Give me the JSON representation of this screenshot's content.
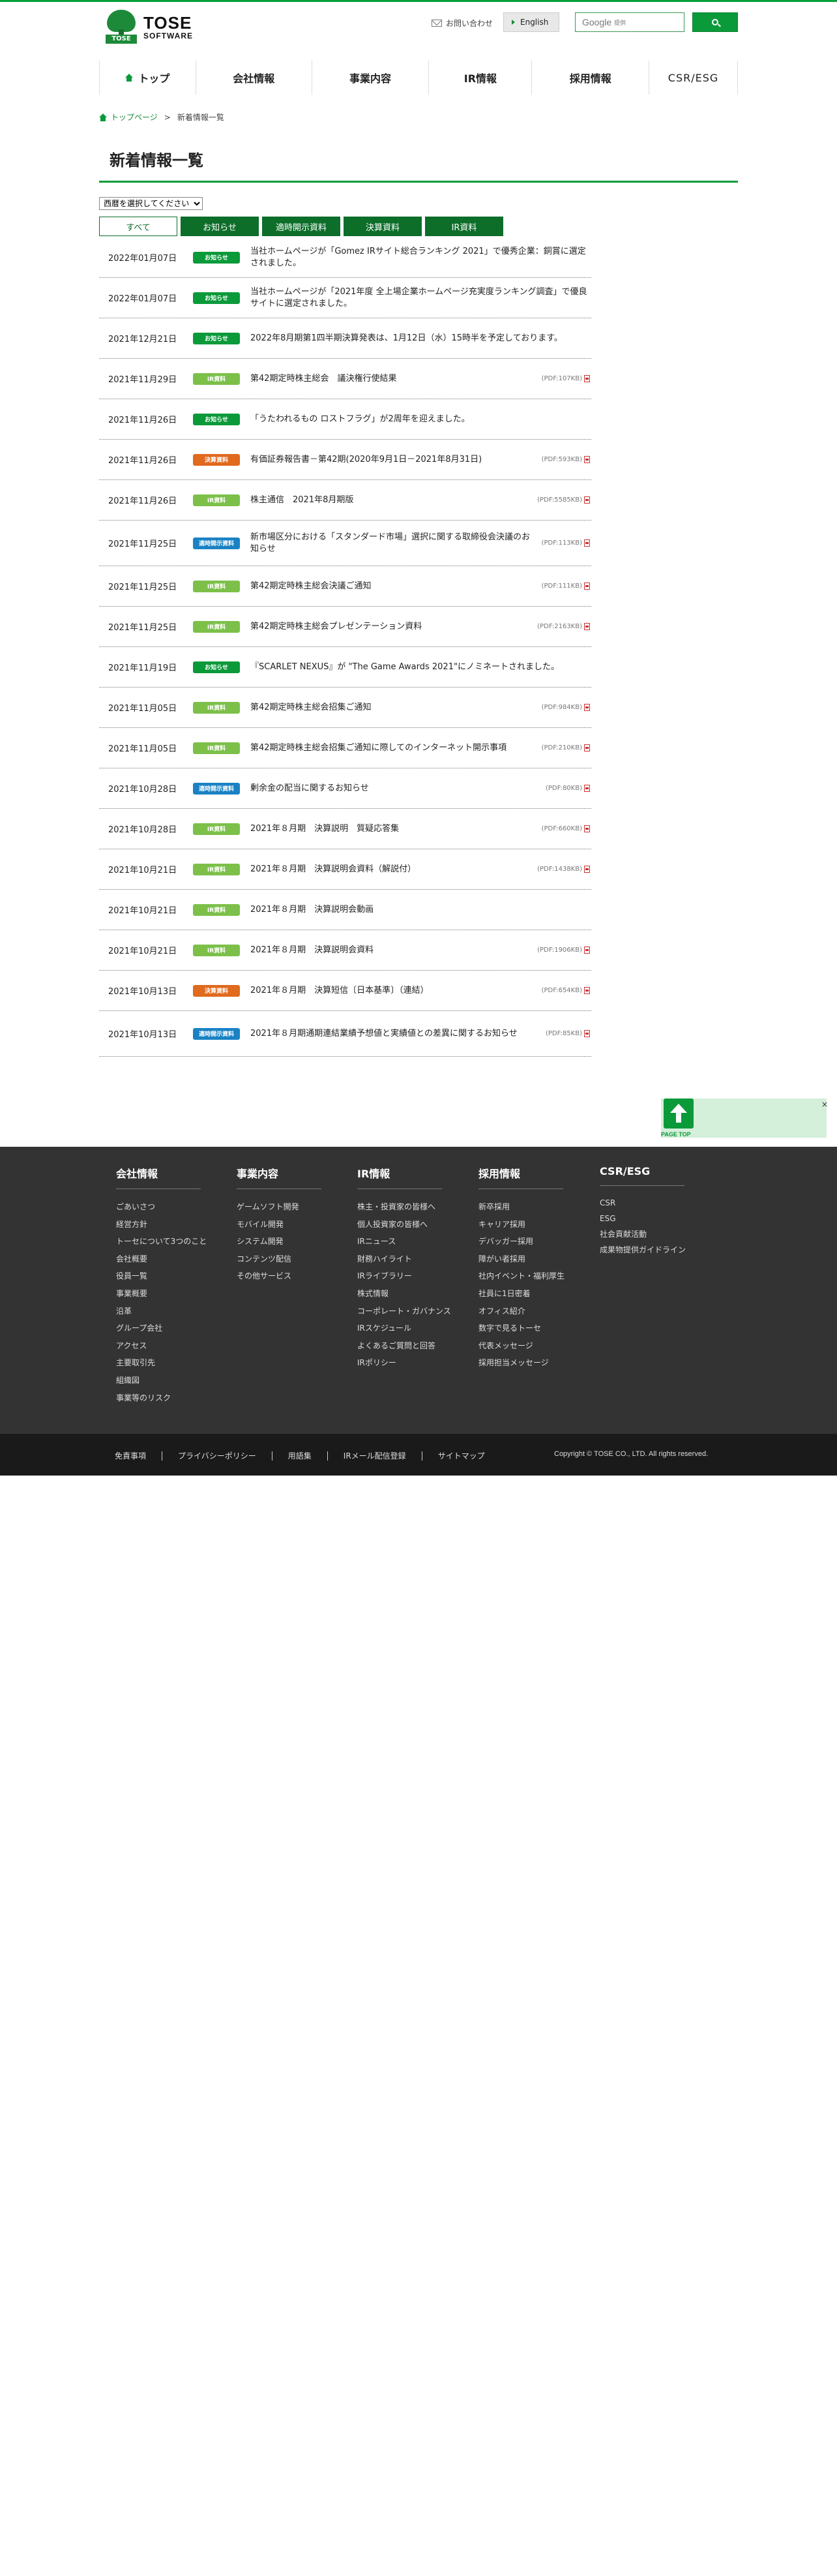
{
  "brand": {
    "logo_mark_text": "TOSE",
    "logo_name_line1": "TOSE",
    "logo_name_line2": "SOFTWARE"
  },
  "header": {
    "contact_label": "お問い合わせ",
    "english_label": "English",
    "search_google": "Google",
    "search_placeholder": "提供"
  },
  "nav": {
    "items": [
      {
        "label": "トップ"
      },
      {
        "label": "会社情報"
      },
      {
        "label": "事業内容"
      },
      {
        "label": "IR情報"
      },
      {
        "label": "採用情報"
      },
      {
        "label": "CSR/ESG"
      }
    ]
  },
  "breadcrumb": {
    "home": "トップページ",
    "separator": ">",
    "current": "新着情報一覧"
  },
  "page_title": "新着情報一覧",
  "filter": {
    "year_select": "西暦を選択してください",
    "tabs": [
      "すべて",
      "お知らせ",
      "適時開示資料",
      "決算資料",
      "IR資料"
    ]
  },
  "badge_colors": {
    "お知らせ": "#0b9a3a",
    "IR資料": "#7cc04a",
    "決算資料": "#e06a1e",
    "適時開示資料": "#1a82c4"
  },
  "news": [
    {
      "date": "2022年01月07日",
      "category": "お知らせ",
      "title": "当社ホームページが「Gomez IRサイト総合ランキング 2021」で優秀企業：銅賞に選定されました。",
      "pdf": ""
    },
    {
      "date": "2022年01月07日",
      "category": "お知らせ",
      "title": "当社ホームページが「2021年度 全上場企業ホームページ充実度ランキング調査」で優良サイトに選定されました。",
      "pdf": ""
    },
    {
      "date": "2021年12月21日",
      "category": "お知らせ",
      "title": "2022年8月期第1四半期決算発表は、1月12日（水）15時半を予定しております。",
      "pdf": ""
    },
    {
      "date": "2021年11月29日",
      "category": "IR資料",
      "title": "第42期定時株主総会　議決権行使結果",
      "pdf": "(PDF:107KB)"
    },
    {
      "date": "2021年11月26日",
      "category": "お知らせ",
      "title": "「うたわれるもの ロストフラグ」が2周年を迎えました。",
      "pdf": ""
    },
    {
      "date": "2021年11月26日",
      "category": "決算資料",
      "title": "有価証券報告書－第42期(2020年9月1日－2021年8月31日)",
      "pdf": "(PDF:593KB)"
    },
    {
      "date": "2021年11月26日",
      "category": "IR資料",
      "title": "株主通信　2021年8月期版",
      "pdf": "(PDF:5585KB)"
    },
    {
      "date": "2021年11月25日",
      "category": "適時開示資料",
      "title": "新市場区分における「スタンダード市場」選択に関する取締役会決議のお知らせ",
      "pdf": "(PDF:113KB)"
    },
    {
      "date": "2021年11月25日",
      "category": "IR資料",
      "title": "第42期定時株主総会決議ご通知",
      "pdf": "(PDF:111KB)"
    },
    {
      "date": "2021年11月25日",
      "category": "IR資料",
      "title": "第42期定時株主総会プレゼンテーション資料",
      "pdf": "(PDF:2163KB)"
    },
    {
      "date": "2021年11月19日",
      "category": "お知らせ",
      "title": "『SCARLET NEXUS』が \"The Game Awards 2021\"にノミネートされました。",
      "pdf": ""
    },
    {
      "date": "2021年11月05日",
      "category": "IR資料",
      "title": "第42期定時株主総会招集ご通知",
      "pdf": "(PDF:984KB)"
    },
    {
      "date": "2021年11月05日",
      "category": "IR資料",
      "title": "第42期定時株主総会招集ご通知に際してのインターネット開示事項",
      "pdf": "(PDF:210KB)"
    },
    {
      "date": "2021年10月28日",
      "category": "適時開示資料",
      "title": "剰余金の配当に関するお知らせ",
      "pdf": "(PDF:80KB)"
    },
    {
      "date": "2021年10月28日",
      "category": "IR資料",
      "title": "2021年８月期　決算説明　質疑応答集",
      "pdf": "(PDF:660KB)"
    },
    {
      "date": "2021年10月21日",
      "category": "IR資料",
      "title": "2021年８月期　決算説明会資料（解説付）",
      "pdf": "(PDF:1438KB)"
    },
    {
      "date": "2021年10月21日",
      "category": "IR資料",
      "title": "2021年８月期　決算説明会動画",
      "pdf": ""
    },
    {
      "date": "2021年10月21日",
      "category": "IR資料",
      "title": "2021年８月期　決算説明会資料",
      "pdf": "(PDF:1906KB)"
    },
    {
      "date": "2021年10月13日",
      "category": "決算資料",
      "title": "2021年８月期　決算短信〔日本基準〕（連結）",
      "pdf": "(PDF:654KB)"
    },
    {
      "date": "2021年10月13日",
      "category": "適時開示資料",
      "title": "2021年８月期通期連結業績予想値と実績値との差異に関するお知らせ",
      "pdf": "(PDF:85KB)"
    }
  ],
  "pagetop": {
    "label": "PAGE TOP",
    "close": "×"
  },
  "footer": {
    "columns": [
      {
        "title": "会社情報",
        "items": [
          "ごあいさつ",
          "経営方針",
          "トーセについて3つのこと",
          "会社概要",
          "役員一覧",
          "事業概要",
          "沿革",
          "グループ会社",
          "アクセス",
          "主要取引先",
          "組織図",
          "事業等のリスク"
        ]
      },
      {
        "title": "事業内容",
        "items": [
          "ゲームソフト開発",
          "モバイル開発",
          "システム開発",
          "コンテンツ配信",
          "その他サービス"
        ]
      },
      {
        "title": "IR情報",
        "items": [
          "株主・投資家の皆様へ",
          "個人投資家の皆様へ",
          "IRニュース",
          "財務ハイライト",
          "IRライブラリー",
          "株式情報",
          "コーポレート・ガバナンス",
          "IRスケジュール",
          "よくあるご質問と回答",
          "IRポリシー"
        ]
      },
      {
        "title": "採用情報",
        "items": [
          "新卒採用",
          "キャリア採用",
          "デバッガー採用",
          "障がい者採用",
          "社内イベント・福利厚生",
          "社員に1日密着",
          "オフィス紹介",
          "数字で見るトーセ",
          "代表メッセージ",
          "採用担当メッセージ"
        ]
      },
      {
        "title": "CSR/ESG",
        "items": [
          "CSR",
          "ESG",
          "社会貢献活動",
          "成果物提供ガイドライン"
        ]
      }
    ],
    "bottom_links": [
      "免責事項",
      "プライバシーポリシー",
      "用語集",
      "IRメール配信登録",
      "サイトマップ"
    ],
    "copyright": "Copyright © TOSE CO., LTD. All rights reserved."
  }
}
